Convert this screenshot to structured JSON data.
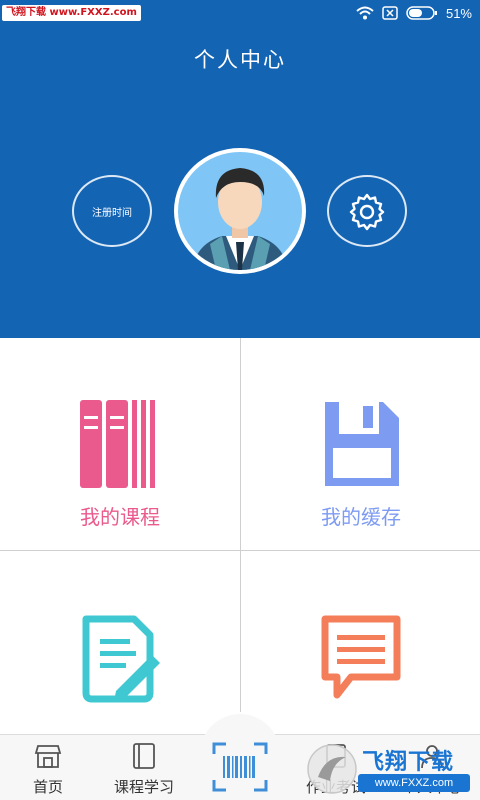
{
  "status_bar": {
    "watermark_text": "飞翔下载 www.FXXZ.com",
    "battery_percent": "51%"
  },
  "header": {
    "title": "个人中心",
    "register_time_label": "注册时间"
  },
  "grid": {
    "courses_label": "我的课程",
    "cache_label": "我的缓存",
    "homework_label": "",
    "message_label": ""
  },
  "bottom_nav": {
    "home_label": "首页",
    "course_study_label": "课程学习",
    "homework_exam_label": "作业考试",
    "personal_center_label": "个人中心"
  },
  "watermark": {
    "brand_text": "飞翔下载",
    "url_text": "www.FXXZ.com"
  },
  "colors": {
    "header_blue": "#1464b4",
    "courses_pink": "#ea5a8c",
    "cache_blue": "#7e9bf2",
    "homework_teal": "#3fc8d2",
    "message_orange": "#f57e5a",
    "scan_blue": "#3f8fd8"
  },
  "icons": {
    "courses": "books-icon",
    "cache": "floppy-disk-icon",
    "homework": "document-pencil-icon",
    "message": "speech-bubble-icon",
    "settings": "gear-icon"
  }
}
